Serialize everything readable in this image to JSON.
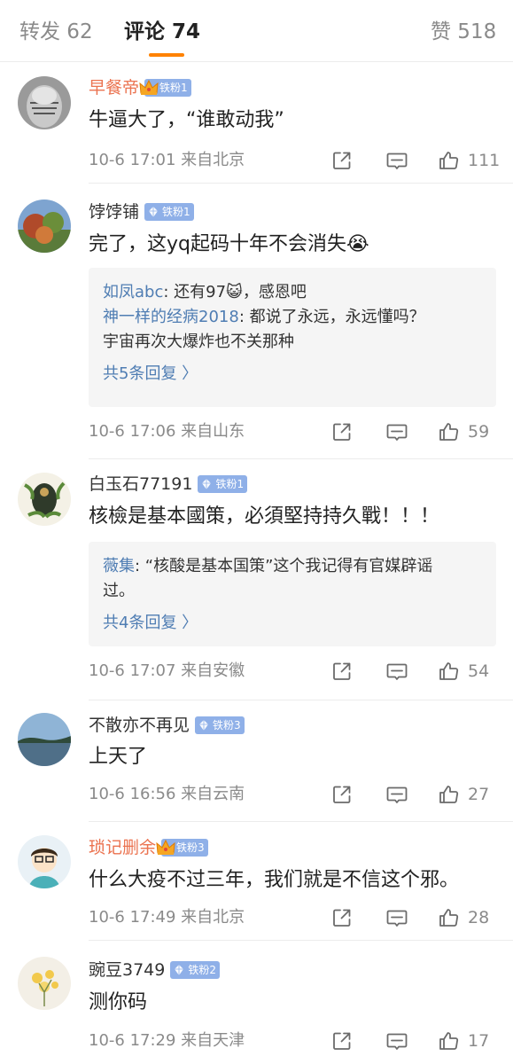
{
  "tabs": {
    "repost": "转发 62",
    "comments": "评论 74",
    "likes": "赞 518"
  },
  "comments": [
    {
      "user": "早餐帝",
      "badge": "铁粉1",
      "text": "牛逼大了，“谁敢动我”",
      "meta": "10-6 17:01 来自北京",
      "likes": "111"
    },
    {
      "user": "饽饽铺",
      "badge": "铁粉1",
      "text": "完了，这yq起码十年不会消失😭",
      "replies": [
        {
          "user": "如凤abc",
          "text": ": 还有97😺，感恩吧"
        },
        {
          "user": "神一样的经病2018",
          "text": ": 都说了永远，永远懂吗？",
          "text2": "宇宙再次大爆炸也不关那种"
        }
      ],
      "more": "共5条回复 〉",
      "meta": "10-6 17:06 来自山东",
      "likes": "59"
    },
    {
      "user": "白玉石77191",
      "badge": "铁粉1",
      "text": "核檢是基本國策，必須堅持持久戰！！！",
      "replies": [
        {
          "user": "薇集",
          "text": ": “核酸是基本国策”这个我记得有官媒辟谣",
          "text2": "过。"
        }
      ],
      "more": "共4条回复 〉",
      "meta": "10-6 17:07 来自安徽",
      "likes": "54"
    },
    {
      "user": "不散亦不再见",
      "badge": "铁粉3",
      "text": "上天了",
      "meta": "10-6 16:56 来自云南",
      "likes": "27"
    },
    {
      "user": "琐记删余",
      "badge": "铁粉3",
      "text": "什么大疫不过三年，我们就是不信这个邪。",
      "meta": "10-6 17:49 来自北京",
      "likes": "28"
    },
    {
      "user": "豌豆3749",
      "badge": "铁粉2",
      "text": "测你码",
      "meta": "10-6 17:29 来自天津",
      "likes": "17"
    }
  ],
  "colors": {
    "accent": "#ff8200",
    "vip_name": "#eb7350",
    "link_blue": "#4f7db3",
    "badge_blue": "#8fb0e8",
    "muted": "#8a8a8a"
  },
  "icons": [
    "crown-icon",
    "diamond-icon",
    "share-icon",
    "comment-icon",
    "like-icon"
  ]
}
